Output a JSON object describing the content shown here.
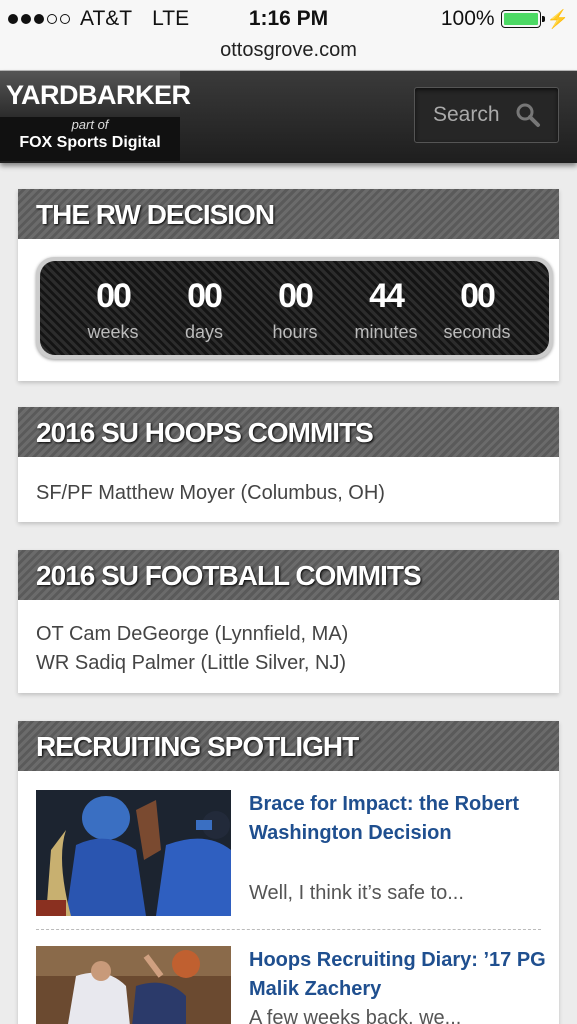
{
  "statusbar": {
    "carrier": "AT&T",
    "network": "LTE",
    "time": "1:16 PM",
    "battery": "100%",
    "signal_bars": 3
  },
  "browser": {
    "url": "ottosgrove.com"
  },
  "header": {
    "logo_main": "YARDBARKER",
    "logo_partof": "part of",
    "logo_sub": "FOX Sports Digital",
    "search_placeholder": "Search"
  },
  "rw_decision": {
    "title": "THE RW DECISION",
    "units": [
      {
        "value": "00",
        "label": "weeks"
      },
      {
        "value": "00",
        "label": "days"
      },
      {
        "value": "00",
        "label": "hours"
      },
      {
        "value": "44",
        "label": "minutes"
      },
      {
        "value": "00",
        "label": "seconds"
      }
    ]
  },
  "hoops": {
    "title": "2016 SU HOOPS COMMITS",
    "items": [
      "SF/PF Matthew Moyer (Columbus, OH)"
    ]
  },
  "football": {
    "title": "2016 SU FOOTBALL COMMITS",
    "items": [
      "OT Cam DeGeorge (Lynnfield, MA)",
      "WR Sadiq Palmer (Little Silver, NJ)"
    ]
  },
  "spotlight": {
    "title": "RECRUITING SPOTLIGHT",
    "articles": [
      {
        "title": "Brace for Impact: the Robert Washington Decision",
        "excerpt": "Well, I think it’s safe to..."
      },
      {
        "title": "Hoops Recruiting Diary: ’17 PG Malik Zachery",
        "excerpt": "A few weeks back, we..."
      }
    ]
  },
  "colors": {
    "link": "#1f4f8f",
    "header_bg": "#2a2a2a",
    "battery": "#4cd964",
    "widget_title_bg": "#636363"
  }
}
